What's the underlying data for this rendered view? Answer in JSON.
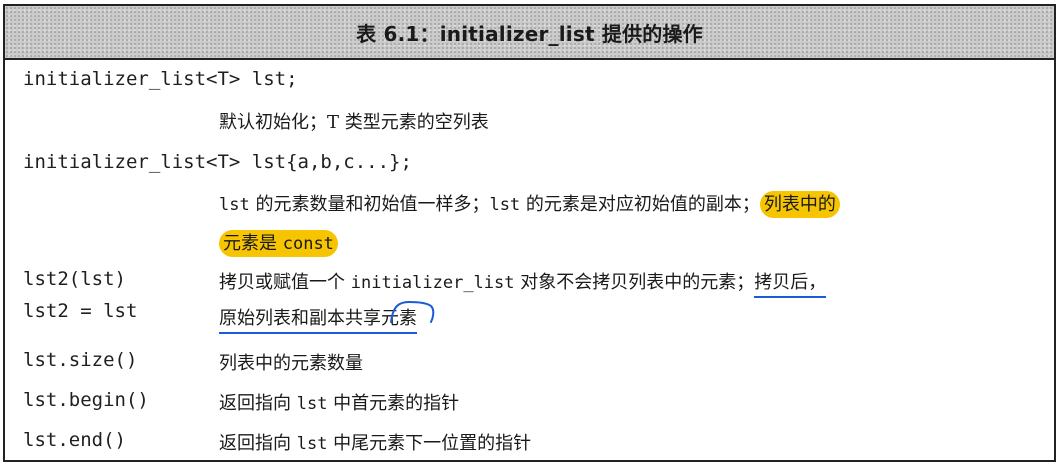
{
  "caption": "表 6.1：initializer_list 提供的操作",
  "rows": [
    {
      "code": [
        "initializer_list<T> lst;"
      ],
      "desc_lines": [
        "默认初始化；T 类型元素的空列表"
      ]
    },
    {
      "code": [
        "initializer_list<T> lst{a,b,c...};"
      ],
      "desc_parts": {
        "l1_code_a": "lst",
        "l1_text_a": " 的元素数量和初始值一样多；",
        "l1_code_b": "lst",
        "l1_text_b": " 的元素是对应初始值的副本；",
        "l1_hl": "列表中的",
        "l2_hl_text": "元素是 ",
        "l2_hl_code": "const"
      }
    },
    {
      "code": [
        "lst2(lst)",
        "lst2 = lst"
      ],
      "desc_parts": {
        "l1_text_a": "拷贝或赋值一个 ",
        "l1_code": "initializer_list",
        "l1_text_b": " 对象不会拷贝列表中的元素；",
        "l1_ul": "拷贝后，",
        "l2_ul": "原始列表和副本共享元素"
      }
    },
    {
      "code": [
        "lst.size()"
      ],
      "desc_lines": [
        "列表中的元素数量"
      ]
    },
    {
      "code": [
        "lst.begin()"
      ],
      "desc_parts": {
        "text_a": "返回指向 ",
        "code": "lst",
        "text_b": " 中首元素的指针"
      }
    },
    {
      "code": [
        "lst.end()"
      ],
      "desc_parts": {
        "text_a": "返回指向 ",
        "code": "lst",
        "text_b": " 中尾元素下一位置的指针"
      }
    }
  ],
  "colors": {
    "highlight": "#f6c400",
    "ink": "#1c5bd8"
  }
}
